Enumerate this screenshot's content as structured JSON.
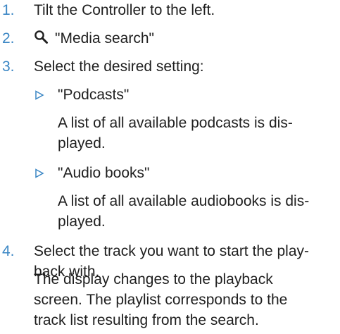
{
  "steps": [
    {
      "number": "1.",
      "text": "Tilt the Controller to the left."
    },
    {
      "number": "2.",
      "icon": "search-icon",
      "text": "\"Media search\""
    },
    {
      "number": "3.",
      "text": "Select the desired setting:"
    },
    {
      "number": "4.",
      "text_line1": "Select the track you want to start the play-",
      "text_line2": "back with."
    }
  ],
  "options": [
    {
      "label": "\"Podcasts\"",
      "desc_line1": "A list of all available podcasts is dis-",
      "desc_line2": "played."
    },
    {
      "label": "\"Audio books\"",
      "desc_line1": "A list of all available audiobooks is dis-",
      "desc_line2": "played."
    }
  ],
  "result": {
    "line1": "The display changes to the playback",
    "line2": "screen. The playlist corresponds to the",
    "line3": "track list resulting from the search."
  },
  "colors": {
    "accent": "#3a86c4",
    "text": "#1f1f1f"
  }
}
